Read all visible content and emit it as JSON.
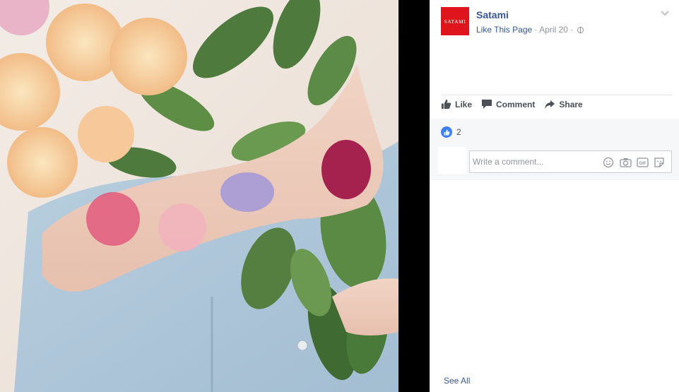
{
  "post": {
    "logo_text": "SATAMI",
    "page_name": "Satami",
    "like_page": "Like This Page",
    "date": "April 20",
    "separator": "·"
  },
  "actions": {
    "like": "Like",
    "comment": "Comment",
    "share": "Share"
  },
  "reactions": {
    "count": "2"
  },
  "comment_box": {
    "placeholder": "Write a comment..."
  },
  "footer": {
    "see_all": "See All"
  },
  "colors": {
    "brand_red": "#e0141d",
    "link_blue": "#365899",
    "like_blue": "#4080ff",
    "muted_gray": "#90949c"
  },
  "icons": [
    "chevron-down-icon",
    "globe-icon",
    "thumbs-up-icon",
    "comment-icon",
    "share-icon",
    "smiley-icon",
    "camera-icon",
    "gif-icon",
    "sticker-icon"
  ]
}
